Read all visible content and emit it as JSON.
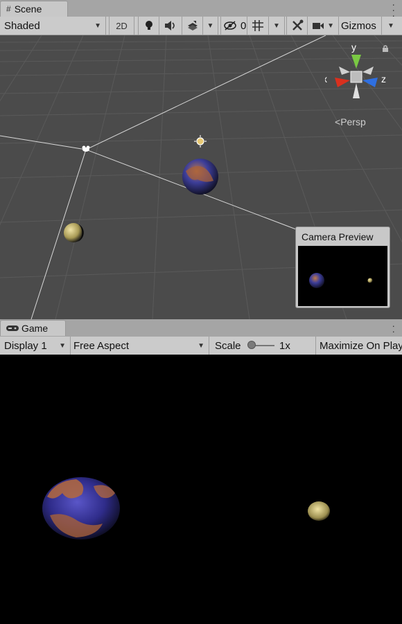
{
  "scene_tab": {
    "label": "Scene"
  },
  "scene_toolbar": {
    "draw_mode": "Shaded",
    "mode_2d": "2D",
    "hidden_count": "0",
    "gizmos": "Gizmos"
  },
  "scene_view": {
    "projection": "Persp",
    "axis_x": "x",
    "axis_y": "y",
    "axis_z": "z",
    "camera_preview_title": "Camera Preview"
  },
  "game_tab": {
    "label": "Game"
  },
  "game_toolbar": {
    "display": "Display 1",
    "aspect": "Free Aspect",
    "scale_label": "Scale",
    "scale_value": "1x",
    "maximize_label": "Maximize On Play"
  },
  "colors": {
    "scene_bg": "#4b4b4b",
    "toolbar_bg": "#cbcbcb",
    "gizmo_x": "#d9301e",
    "gizmo_y": "#7ac943",
    "gizmo_z": "#2f6fe0"
  }
}
